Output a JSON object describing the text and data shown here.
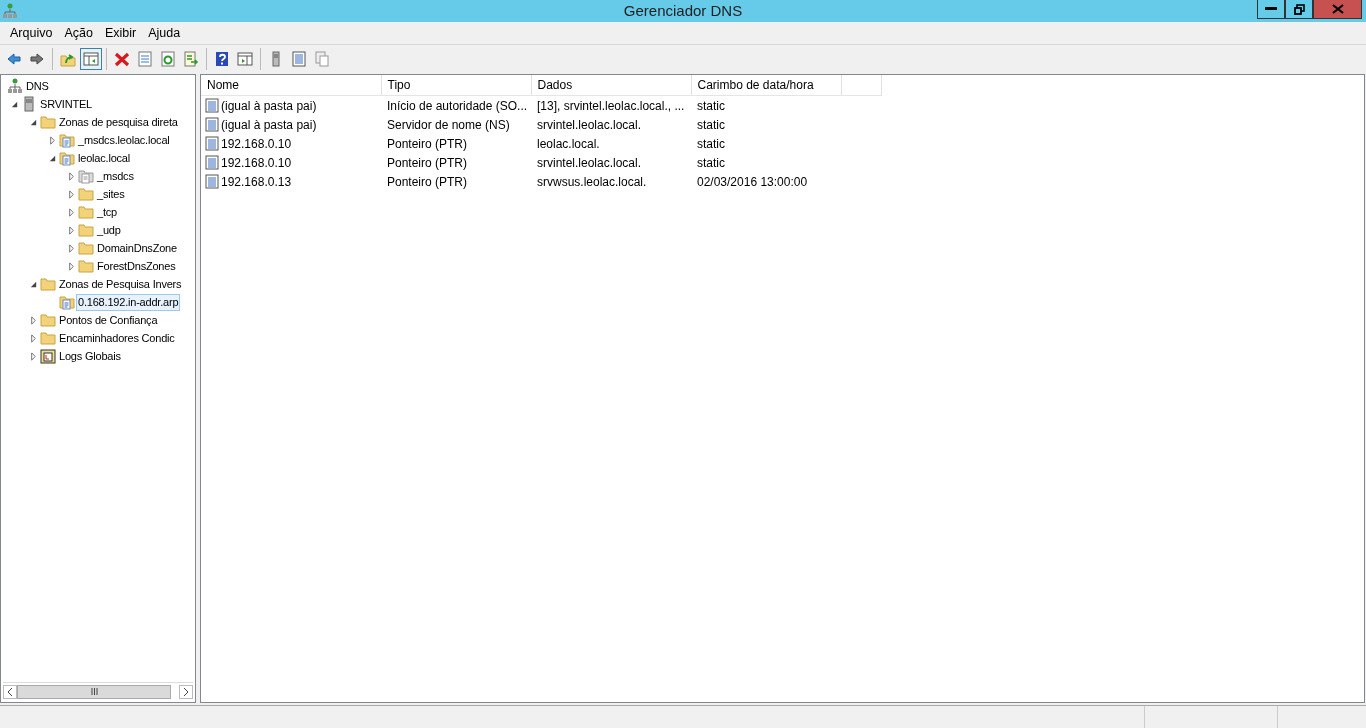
{
  "window": {
    "title": "Gerenciador DNS"
  },
  "menu": [
    "Arquivo",
    "Ação",
    "Exibir",
    "Ajuda"
  ],
  "toolbar": [
    {
      "kind": "back",
      "pressed": false
    },
    {
      "kind": "forward",
      "pressed": false
    },
    {
      "kind": "sep"
    },
    {
      "kind": "up",
      "pressed": false
    },
    {
      "kind": "tree",
      "pressed": true
    },
    {
      "kind": "sep"
    },
    {
      "kind": "delete",
      "pressed": false
    },
    {
      "kind": "props",
      "pressed": false
    },
    {
      "kind": "refresh",
      "pressed": false
    },
    {
      "kind": "export",
      "pressed": false
    },
    {
      "kind": "sep"
    },
    {
      "kind": "help",
      "pressed": false
    },
    {
      "kind": "action",
      "pressed": false
    },
    {
      "kind": "sep"
    },
    {
      "kind": "server",
      "pressed": false
    },
    {
      "kind": "list",
      "pressed": false
    },
    {
      "kind": "copy",
      "pressed": false
    }
  ],
  "tree": [
    {
      "label": "DNS",
      "kind": "dns",
      "selected": false,
      "children": [
        {
          "label": "SRVINTEL",
          "kind": "server",
          "expanded": true,
          "selected": false,
          "children": [
            {
              "label": "Zonas de pesquisa direta",
              "kind": "folder",
              "expanded": true,
              "selected": false,
              "children": [
                {
                  "label": "_msdcs.leolac.local",
                  "kind": "zone",
                  "expanded": false,
                  "selected": false
                },
                {
                  "label": "leolac.local",
                  "kind": "zone",
                  "expanded": true,
                  "selected": false,
                  "children": [
                    {
                      "label": "_msdcs",
                      "kind": "zone-grey",
                      "expanded": false,
                      "selected": false
                    },
                    {
                      "label": "_sites",
                      "kind": "folder",
                      "expanded": false,
                      "selected": false
                    },
                    {
                      "label": "_tcp",
                      "kind": "folder",
                      "expanded": false,
                      "selected": false
                    },
                    {
                      "label": "_udp",
                      "kind": "folder",
                      "expanded": false,
                      "selected": false
                    },
                    {
                      "label": "DomainDnsZone",
                      "kind": "folder",
                      "expanded": false,
                      "selected": false
                    },
                    {
                      "label": "ForestDnsZones",
                      "kind": "folder",
                      "expanded": false,
                      "selected": false
                    }
                  ]
                }
              ]
            },
            {
              "label": "Zonas de Pesquisa Invers",
              "kind": "folder",
              "expanded": true,
              "selected": false,
              "children": [
                {
                  "label": "0.168.192.in-addr.arp",
                  "kind": "zone",
                  "selected": true
                }
              ]
            },
            {
              "label": "Pontos de Confiança",
              "kind": "folder",
              "expanded": false,
              "selected": false
            },
            {
              "label": "Encaminhadores Condic",
              "kind": "folder",
              "expanded": false,
              "selected": false
            },
            {
              "label": "Logs Globais",
              "kind": "logs",
              "expanded": false,
              "selected": false
            }
          ]
        }
      ]
    }
  ],
  "table": {
    "columns": [
      "Nome",
      "Tipo",
      "Dados",
      "Carimbo de data/hora"
    ],
    "rows": [
      [
        "(igual à pasta pai)",
        "Início de autoridade (SO...",
        "[13], srvintel.leolac.local., ...",
        "static"
      ],
      [
        "(igual à pasta pai)",
        "Servidor de nome (NS)",
        "srvintel.leolac.local.",
        "static"
      ],
      [
        "192.168.0.10",
        "Ponteiro (PTR)",
        "leolac.local.",
        "static"
      ],
      [
        "192.168.0.10",
        "Ponteiro (PTR)",
        "srvintel.leolac.local.",
        "static"
      ],
      [
        "192.168.0.13",
        "Ponteiro (PTR)",
        "srvwsus.leolac.local.",
        "02/03/2016 13:00:00"
      ]
    ]
  }
}
